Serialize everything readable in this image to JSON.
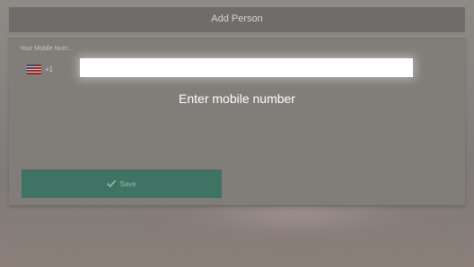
{
  "window": {
    "title": "Add Person"
  },
  "form": {
    "mobile_label": "Your Mobile Num...",
    "country_code": "+1",
    "mobile_value": "",
    "hint": "Enter mobile number",
    "flag_icon": "flag-icon",
    "save_label": "Save",
    "save_icon": "check-icon"
  },
  "colors": {
    "background": "#827f7b",
    "titlebar": "#6f6c69",
    "dialog": "#817d79",
    "button": "#3f7363",
    "text_on_dark": "#ffffff"
  }
}
